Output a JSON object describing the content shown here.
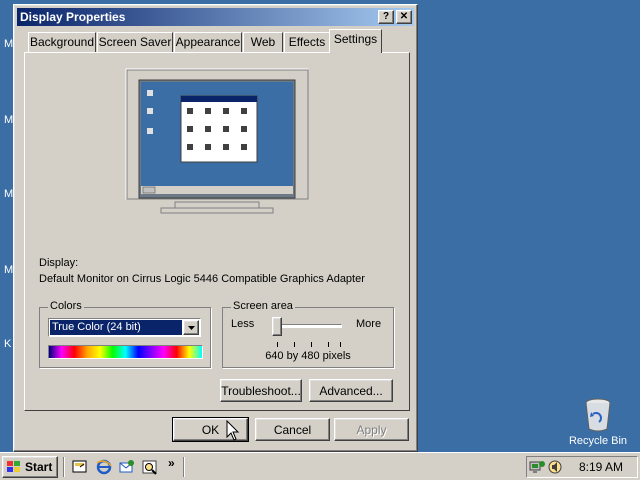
{
  "desktop": {
    "labels": [
      "My",
      "My",
      "M",
      "Mo",
      "K"
    ],
    "recycle_bin": "Recycle Bin"
  },
  "window": {
    "title": "Display Properties",
    "help_glyph": "?",
    "close_glyph": "✕",
    "tabs": [
      "Background",
      "Screen Saver",
      "Appearance",
      "Web",
      "Effects",
      "Settings"
    ],
    "active_tab": "Settings"
  },
  "settings": {
    "display_label": "Display:",
    "display_value": "Default Monitor on Cirrus Logic 5446 Compatible Graphics Adapter",
    "colors": {
      "group_label": "Colors",
      "selected": "True Color (24 bit)"
    },
    "screen_area": {
      "group_label": "Screen area",
      "less": "Less",
      "more": "More",
      "value": "640 by 480 pixels",
      "slider_level": 0
    },
    "troubleshoot_label": "Troubleshoot...",
    "advanced_label": "Advanced..."
  },
  "footer": {
    "ok_label": "OK",
    "cancel_label": "Cancel",
    "apply_label": "Apply"
  },
  "taskbar": {
    "start_label": "Start",
    "chevron": "»",
    "clock": "8:19 AM"
  },
  "colors": {
    "desktop": "#3a6ea5",
    "title_active": "#0a246a",
    "face": "#d4d0c8",
    "selection": "#0a246a"
  }
}
